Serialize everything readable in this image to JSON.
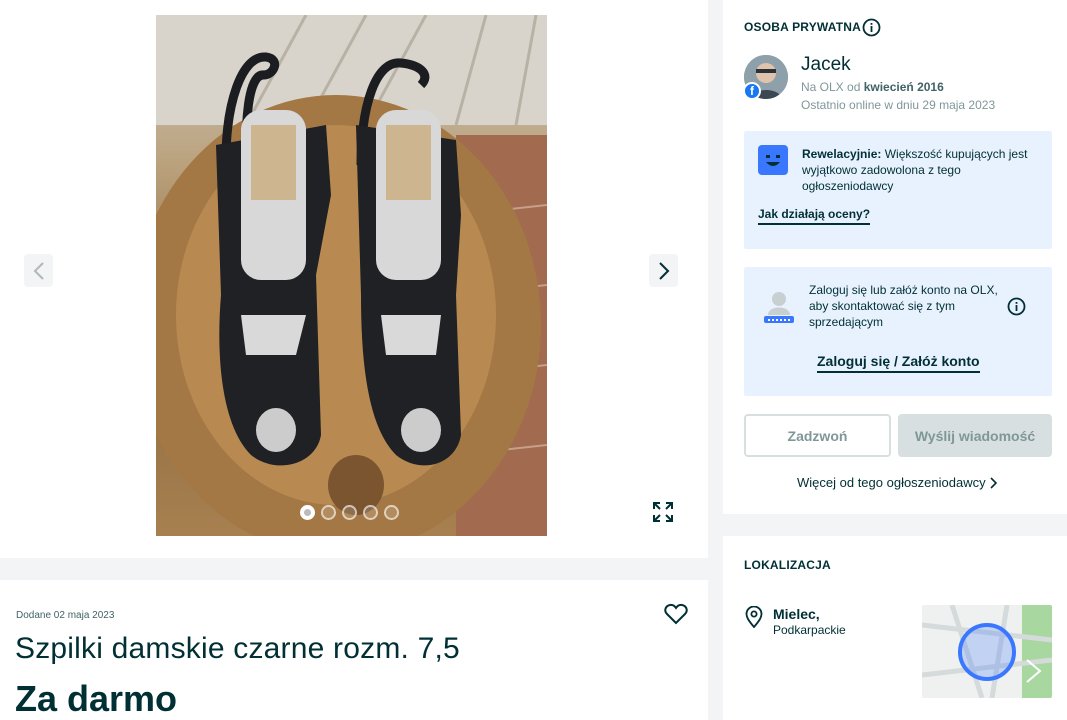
{
  "gallery": {
    "photo_alt": "Szpilki damskie czarne",
    "photo_count": 5,
    "active_photo_index": 0
  },
  "ad": {
    "posted_date": "Dodane 02 maja 2023",
    "title": "Szpilki damskie czarne rozm. 7,5",
    "price": "Za darmo"
  },
  "seller": {
    "section_label": "OSOBA PRYWATNA",
    "name": "Jacek",
    "member_prefix": "Na OLX od",
    "member_since": "kwiecień 2016",
    "last_online": "Ostatnio online w dniu 29 maja 2023",
    "rating_strong": "Rewelacyjnie:",
    "rating_text": " Większość kupujących jest wyjątkowo zadowolona z tego ogłoszeniodawcy",
    "rating_link": "Jak działają oceny?",
    "login_prompt": "Zaloguj się lub załóż konto na OLX, aby skontaktować się z tym sprzedającym",
    "login_link": "Zaloguj się / Załóż konto",
    "call_button": "Zadzwoń",
    "message_button": "Wyślij wiadomość",
    "more_link": "Więcej od tego ogłoszeniodawcy"
  },
  "location": {
    "section_label": "LOKALIZACJA",
    "city": "Mielec,",
    "region": "Podkarpackie"
  },
  "colors": {
    "text_primary": "#002f34",
    "info_box_bg": "#e8f2ff",
    "facebook_blue": "#1877f2",
    "map_marker": "#3a77ff"
  }
}
